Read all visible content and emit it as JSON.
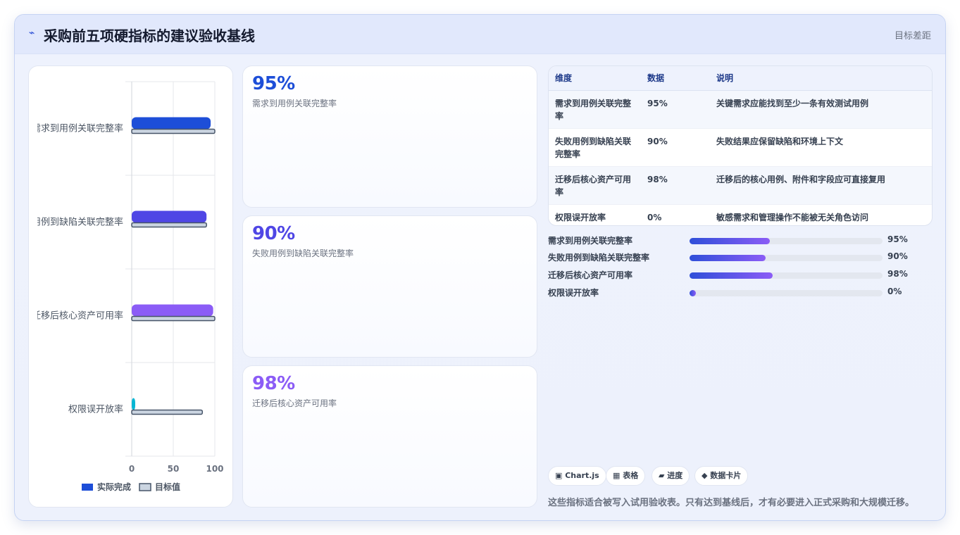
{
  "header": {
    "logo_glyph": "⌁",
    "title": "采购前五项硬指标的建议验收基线",
    "right_label": "目标差距"
  },
  "chart_data": {
    "type": "bar",
    "orientation": "horizontal",
    "categories": [
      "需求到用例关联完整率",
      "失败用例到缺陷关联完整率",
      "迁移后核心资产可用率",
      "权限误开放率"
    ],
    "series": [
      {
        "name": "实际完成",
        "values": [
          95,
          90,
          98,
          0
        ],
        "colors": [
          "#1d4ed8",
          "#4f46e5",
          "#8b5cf6",
          "#06b6d4"
        ]
      },
      {
        "name": "目标值",
        "values": [
          100,
          90,
          100,
          85
        ],
        "color": "#cbd5e1"
      }
    ],
    "xlim": [
      0,
      100
    ],
    "xticks": [
      "0",
      "50",
      "100"
    ],
    "legend": "bottom",
    "grid": true
  },
  "stat_cards": [
    {
      "value": "95%",
      "label": "需求到用例关联完整率",
      "color": "#1d4ed8"
    },
    {
      "value": "90%",
      "label": "失败用例到缺陷关联完整率",
      "color": "#4f46e5"
    },
    {
      "value": "98%",
      "label": "迁移后核心资产可用率",
      "color": "#8b5cf6"
    }
  ],
  "table": {
    "headers": [
      "维度",
      "数据",
      "说明"
    ],
    "rows": [
      [
        "需求到用例关联完整率",
        "95%",
        "关键需求应能找到至少一条有效测试用例"
      ],
      [
        "失败用例到缺陷关联完整率",
        "90%",
        "失败结果应保留缺陷和环境上下文"
      ],
      [
        "迁移后核心资产可用率",
        "98%",
        "迁移后的核心用例、附件和字段应可直接复用"
      ],
      [
        "权限误开放率",
        "0%",
        "敏感需求和管理操作不能被无关角色访问"
      ]
    ]
  },
  "progress": [
    {
      "label": "需求到用例关联完整率",
      "value": 95,
      "text": "95%"
    },
    {
      "label": "失败用例到缺陷关联完整率",
      "value": 90,
      "text": "90%"
    },
    {
      "label": "迁移后核心资产可用率",
      "value": 98,
      "text": "98%"
    },
    {
      "label": "权限误开放率",
      "value": 0,
      "text": "0%"
    }
  ],
  "chips": [
    "▣ Chart.js",
    "▦ 表格",
    "▰ 进度",
    "◆ 数据卡片"
  ],
  "footnote": "这些指标适合被写入试用验收表。只有达到基线后，才有必要进入正式采购和大规模迁移。"
}
